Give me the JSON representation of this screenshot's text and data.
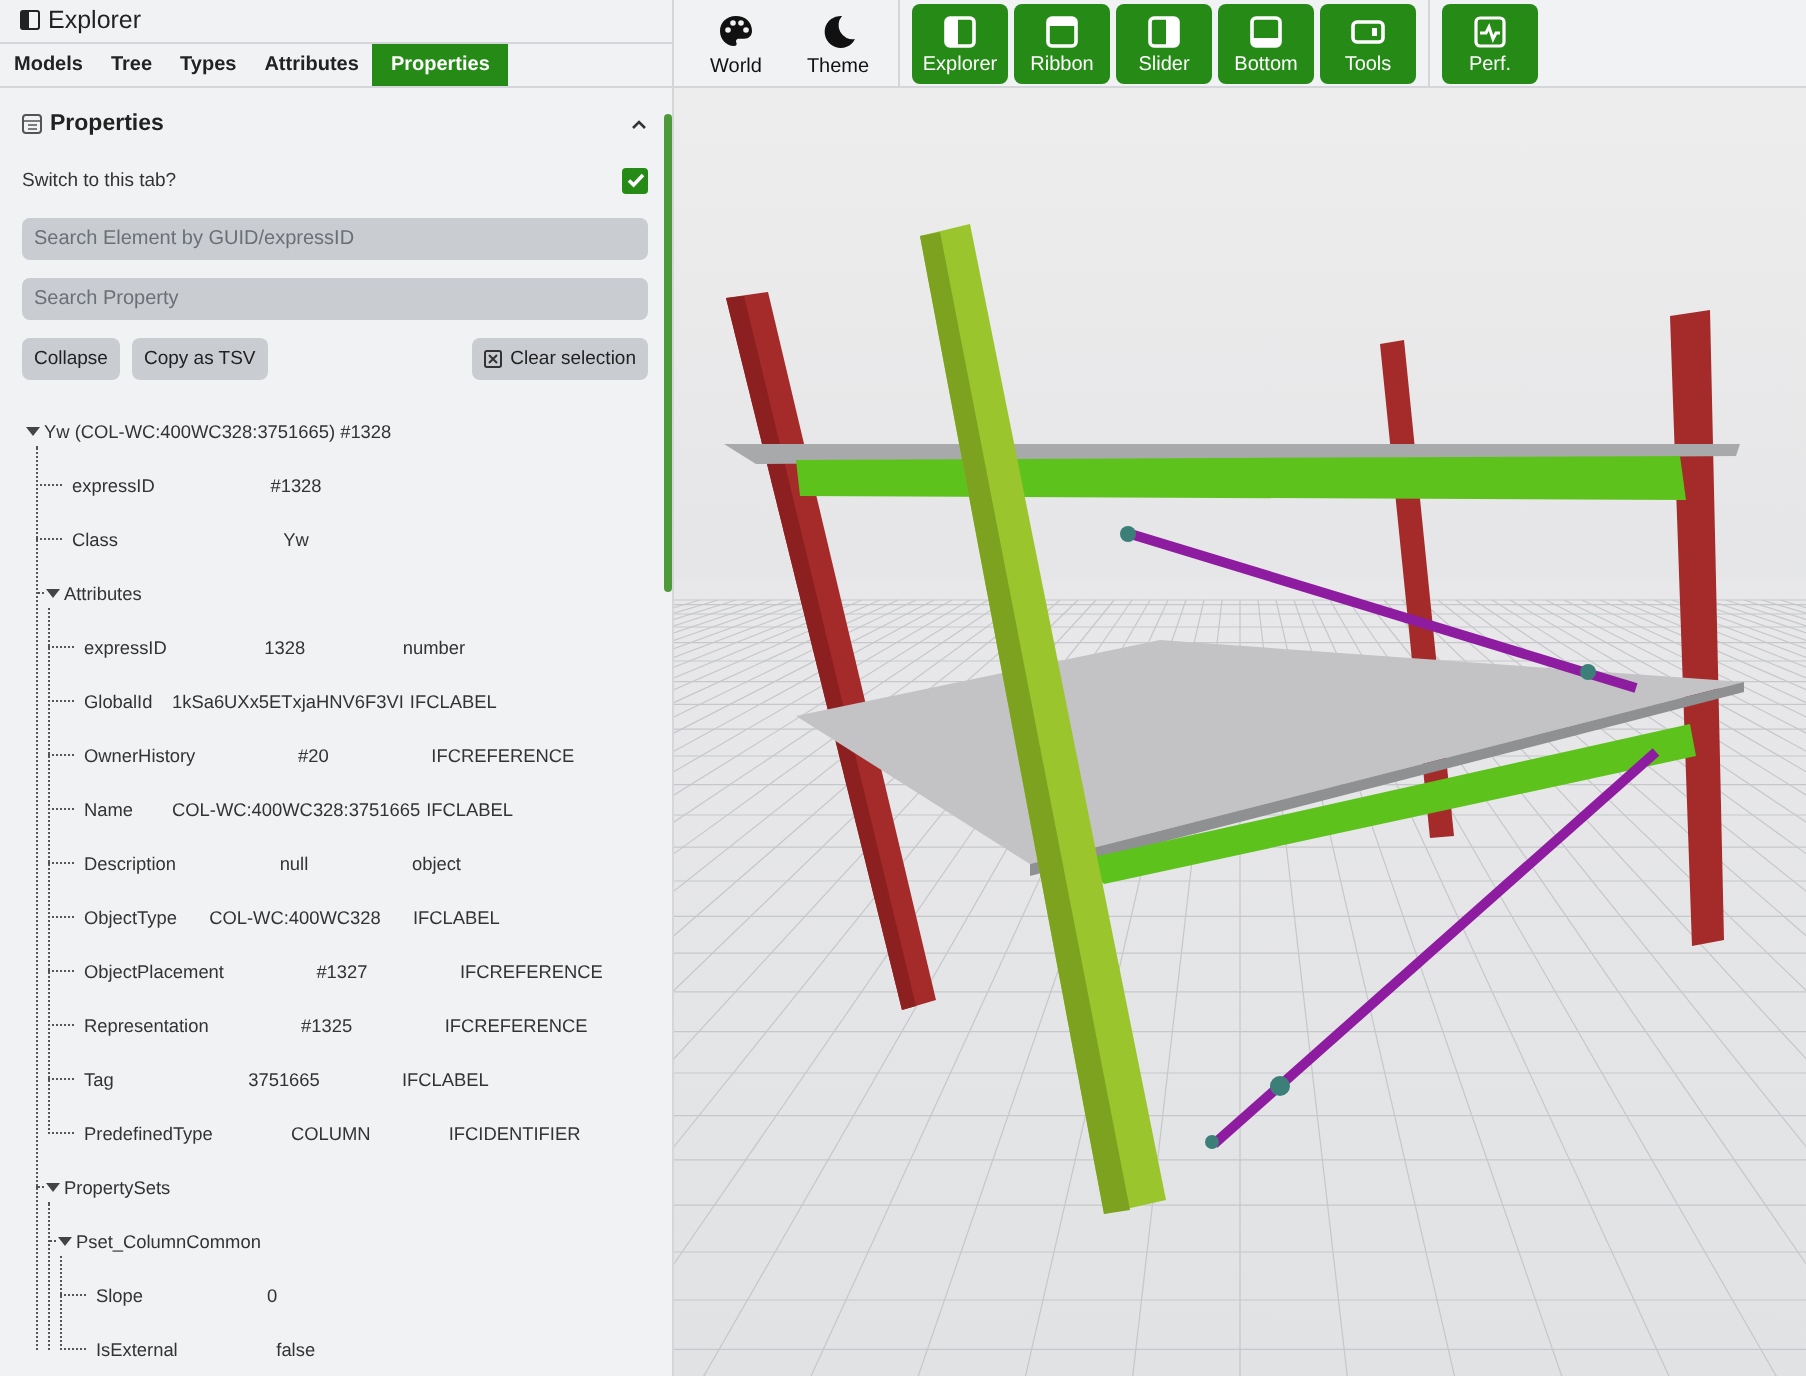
{
  "panel": {
    "title": "Explorer",
    "tabs": [
      {
        "label": "Models",
        "selected": false
      },
      {
        "label": "Tree",
        "selected": false
      },
      {
        "label": "Types",
        "selected": false
      },
      {
        "label": "Attributes",
        "selected": false
      },
      {
        "label": "Properties",
        "selected": true
      }
    ],
    "section": {
      "title": "Properties",
      "expanded": true,
      "switch_label": "Switch to this tab?",
      "switch_checked": true,
      "search_fields": [
        {
          "placeholder": "Search Element by GUID/expressID"
        },
        {
          "placeholder": "Search Property"
        }
      ],
      "buttons": [
        {
          "label": "Collapse",
          "kind": "text"
        },
        {
          "label": "Copy as TSV",
          "kind": "text"
        },
        {
          "label": "Clear selection",
          "kind": "clear"
        }
      ],
      "tree": [
        {
          "key": "Yw (COL-WC:400WC328:3751665) #1328",
          "expanded": true,
          "children": [
            {
              "key": "expressID",
              "value": "#1328"
            },
            {
              "key": "Class",
              "value": "Yw"
            },
            {
              "key": "Attributes",
              "expanded": true,
              "children": [
                {
                  "key": "expressID",
                  "value": "1328",
                  "type": "number"
                },
                {
                  "key": "GlobalId",
                  "value": "1kSa6UXx5ETxjaHNV6F3VI",
                  "type": "IFCLABEL"
                },
                {
                  "key": "OwnerHistory",
                  "value": "#20",
                  "type": "IFCREFERENCE"
                },
                {
                  "key": "Name",
                  "value": "COL-WC:400WC328:3751665",
                  "type": "IFCLABEL"
                },
                {
                  "key": "Description",
                  "value": "null",
                  "type": "object"
                },
                {
                  "key": "ObjectType",
                  "value": "COL-WC:400WC328",
                  "type": "IFCLABEL"
                },
                {
                  "key": "ObjectPlacement",
                  "value": "#1327",
                  "type": "IFCREFERENCE"
                },
                {
                  "key": "Representation",
                  "value": "#1325",
                  "type": "IFCREFERENCE"
                },
                {
                  "key": "Tag",
                  "value": "3751665",
                  "type": "IFCLABEL"
                },
                {
                  "key": "PredefinedType",
                  "value": "COLUMN",
                  "type": "IFCIDENTIFIER"
                }
              ]
            },
            {
              "key": "PropertySets",
              "expanded": true,
              "children": [
                {
                  "key": "Pset_ColumnCommon",
                  "expanded": true,
                  "children": [
                    {
                      "key": "Slope",
                      "value": "0"
                    },
                    {
                      "key": "IsExternal",
                      "value": "false"
                    }
                  ]
                }
              ]
            }
          ]
        }
      ]
    }
  },
  "toolbar": {
    "groups": [
      [
        {
          "label": "World",
          "active": false
        },
        {
          "label": "Theme",
          "active": false
        }
      ],
      [
        {
          "label": "Explorer",
          "active": true
        },
        {
          "label": "Ribbon",
          "active": true
        },
        {
          "label": "Slider",
          "active": true
        },
        {
          "label": "Bottom",
          "active": true
        },
        {
          "label": "Tools",
          "active": true
        }
      ],
      [
        {
          "label": "Perf.",
          "active": true
        }
      ]
    ]
  }
}
